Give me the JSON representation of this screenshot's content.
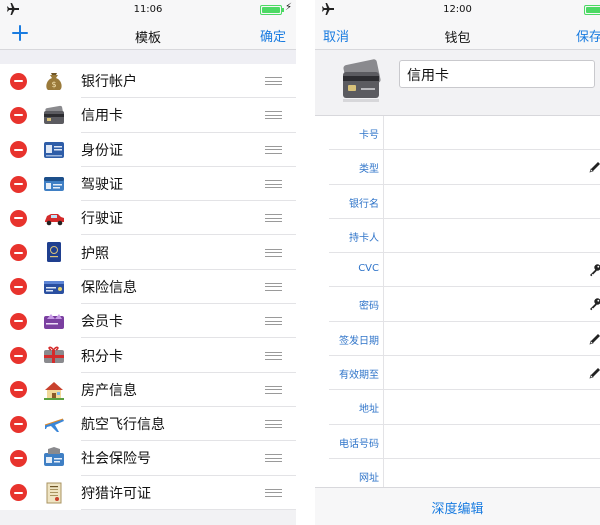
{
  "left": {
    "status": {
      "time": "11:06"
    },
    "nav": {
      "title": "模板",
      "confirm": "确定"
    },
    "items": [
      {
        "label": "银行帐户",
        "icon": "money-bag-icon"
      },
      {
        "label": "信用卡",
        "icon": "credit-card-icon"
      },
      {
        "label": "身份证",
        "icon": "id-card-icon"
      },
      {
        "label": "驾驶证",
        "icon": "driver-license-icon"
      },
      {
        "label": "行驶证",
        "icon": "car-icon"
      },
      {
        "label": "护照",
        "icon": "passport-icon"
      },
      {
        "label": "保险信息",
        "icon": "insurance-card-icon"
      },
      {
        "label": "会员卡",
        "icon": "membership-card-icon"
      },
      {
        "label": "积分卡",
        "icon": "gift-card-icon"
      },
      {
        "label": "房产信息",
        "icon": "house-icon"
      },
      {
        "label": "航空飞行信息",
        "icon": "airplane-icon"
      },
      {
        "label": "社会保险号",
        "icon": "social-security-icon"
      },
      {
        "label": "狩猎许可证",
        "icon": "license-document-icon"
      }
    ]
  },
  "right": {
    "status": {
      "time": "12:00"
    },
    "nav": {
      "cancel": "取消",
      "title": "钱包",
      "save": "保存"
    },
    "name_value": "信用卡",
    "fields": [
      {
        "label": "卡号",
        "icon": ""
      },
      {
        "label": "类型",
        "icon": "pencil-icon"
      },
      {
        "label": "银行名",
        "icon": ""
      },
      {
        "label": "持卡人",
        "icon": ""
      },
      {
        "label": "CVC",
        "icon": "key-icon"
      },
      {
        "label": "密码",
        "icon": "key-icon"
      },
      {
        "label": "签发日期",
        "icon": "pencil-icon"
      },
      {
        "label": "有效期至",
        "icon": "pencil-icon"
      },
      {
        "label": "地址",
        "icon": ""
      },
      {
        "label": "电话号码",
        "icon": ""
      },
      {
        "label": "网址",
        "icon": ""
      }
    ],
    "bottom_button": "深度编辑"
  },
  "colors": {
    "accent": "#1a7ce0",
    "delete": "#e8332d",
    "battery": "#4cd964",
    "label": "#2f74c9"
  }
}
